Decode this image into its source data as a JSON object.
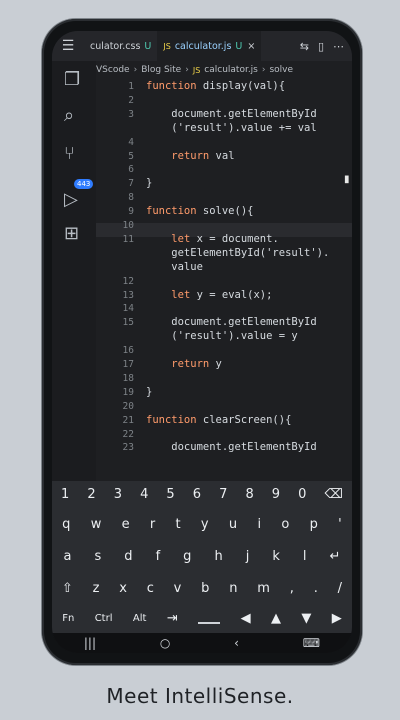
{
  "caption": "Meet IntelliSense.",
  "tabs": [
    {
      "label": "culator.css",
      "mod": "U"
    },
    {
      "label": "calculator.js",
      "lang": "JS",
      "mod": "U"
    }
  ],
  "breadcrumbs": [
    "VScode",
    "Blog Site",
    "JS",
    "calculator.js",
    "solve"
  ],
  "badge": "443",
  "editor": {
    "lines": [
      {
        "n": "1",
        "t": "function display(val){"
      },
      {
        "n": "2",
        "t": ""
      },
      {
        "n": "3",
        "t": "    document.getElementById"
      },
      {
        "n": "",
        "t": "    ('result').value += val"
      },
      {
        "n": "4",
        "t": ""
      },
      {
        "n": "5",
        "t": "    return val"
      },
      {
        "n": "6",
        "t": ""
      },
      {
        "n": "7",
        "t": "}"
      },
      {
        "n": "8",
        "t": ""
      },
      {
        "n": "9",
        "t": "function solve(){"
      },
      {
        "n": "10",
        "t": ""
      },
      {
        "n": "11",
        "t": "    let x = document."
      },
      {
        "n": "",
        "t": "    getElementById('result')."
      },
      {
        "n": "",
        "t": "    value"
      },
      {
        "n": "12",
        "t": ""
      },
      {
        "n": "13",
        "t": "    let y = eval(x);"
      },
      {
        "n": "14",
        "t": ""
      },
      {
        "n": "15",
        "t": "    document.getElementById"
      },
      {
        "n": "",
        "t": "    ('result').value = y"
      },
      {
        "n": "16",
        "t": ""
      },
      {
        "n": "17",
        "t": "    return y"
      },
      {
        "n": "18",
        "t": ""
      },
      {
        "n": "19",
        "t": "}"
      },
      {
        "n": "20",
        "t": ""
      },
      {
        "n": "21",
        "t": "function clearScreen(){"
      },
      {
        "n": "22",
        "t": ""
      },
      {
        "n": "23",
        "t": "    document.getElementById"
      }
    ]
  },
  "keyboard": {
    "row1": [
      "1",
      "2",
      "3",
      "4",
      "5",
      "6",
      "7",
      "8",
      "9",
      "0",
      "⌫"
    ],
    "row2": [
      "q",
      "w",
      "e",
      "r",
      "t",
      "y",
      "u",
      "i",
      "o",
      "p",
      "'"
    ],
    "row3": [
      "a",
      "s",
      "d",
      "f",
      "g",
      "h",
      "j",
      "k",
      "l",
      "↵"
    ],
    "row4": [
      "⇧",
      "z",
      "x",
      "c",
      "v",
      "b",
      "n",
      "m",
      ",",
      ".",
      "/"
    ],
    "row5": [
      "Fn",
      "Ctrl",
      "Alt",
      "⇥",
      "space",
      "◀",
      "▲",
      "▼",
      "▶"
    ]
  },
  "navbar": [
    "|||",
    "○",
    "‹",
    "⌨"
  ],
  "colors": {
    "background": "#c9ced4",
    "editor": "#1e1f22",
    "keyword": "#ff9b6b",
    "accent": "#2f7cff"
  }
}
